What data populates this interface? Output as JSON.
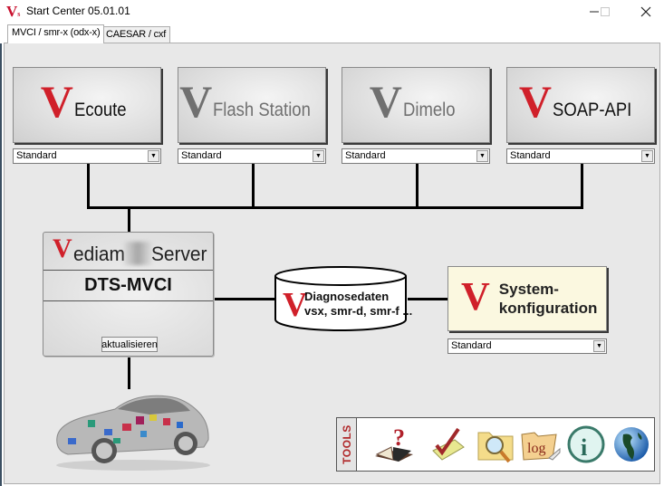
{
  "window": {
    "app_icon": "V",
    "title": "Start Center 05.01.01",
    "controls": [
      "minimize",
      "maximize",
      "close"
    ]
  },
  "tabs": [
    {
      "label": "MVCI / smr-x (odx-x)",
      "active": true
    },
    {
      "label": "CAESAR / cxf",
      "active": false
    }
  ],
  "applications": [
    {
      "name": "Ecoute",
      "enabled": true,
      "profile": "Standard"
    },
    {
      "name": "Flash Station",
      "enabled": false,
      "profile": "Standard"
    },
    {
      "name": "Dimelo",
      "enabled": false,
      "profile": "Standard"
    },
    {
      "name": "SOAP-API",
      "enabled": true,
      "profile": "Standard"
    }
  ],
  "server": {
    "title_prefix": "V",
    "title": "ediam",
    "title_suffix": "Server",
    "subtitle": "DTS-MVCI",
    "refresh_label": "aktualisieren"
  },
  "database": {
    "line1": "Diagnosedaten",
    "line2": "vsx, smr-d, smr-f ..."
  },
  "system_config": {
    "line1": "System-",
    "line2": "konfiguration",
    "profile": "Standard"
  },
  "vehicle": {
    "image": "car-with-control-units"
  },
  "tools": {
    "label": "TOOLS",
    "items": [
      {
        "name": "help-book-icon"
      },
      {
        "name": "checklist-icon"
      },
      {
        "name": "folder-search-icon"
      },
      {
        "name": "log-folder-icon"
      },
      {
        "name": "info-icon"
      },
      {
        "name": "globe-icon"
      }
    ]
  },
  "colors": {
    "brand_red": "#d0202a",
    "disabled_grey": "#707070",
    "background": "#e8e8e8",
    "config_box": "#fbf8e0"
  }
}
